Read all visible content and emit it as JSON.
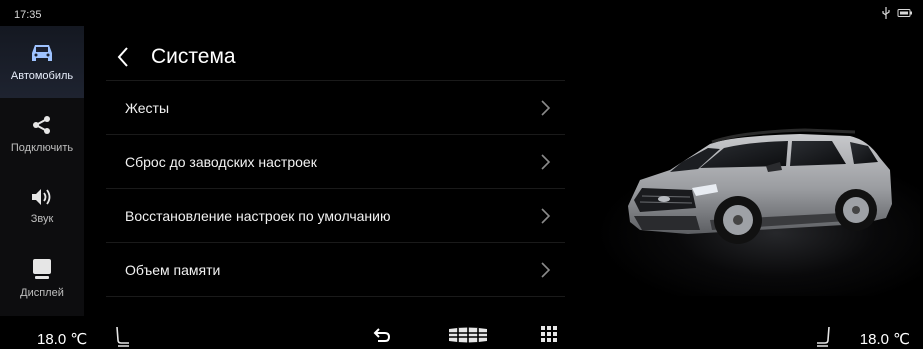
{
  "status": {
    "time": "17:35",
    "usb_icon": "usb-icon",
    "battery_icon": "battery-icon"
  },
  "sidebar": {
    "items": [
      {
        "label": "Автомобиль",
        "icon": "car-icon",
        "active": true
      },
      {
        "label": "Подключить",
        "icon": "share-icon",
        "active": false
      },
      {
        "label": "Звук",
        "icon": "speaker-icon",
        "active": false
      },
      {
        "label": "Дисплей",
        "icon": "display-icon",
        "active": false
      }
    ]
  },
  "header": {
    "title": "Система",
    "back_icon": "chevron-left-icon"
  },
  "menu": {
    "items": [
      {
        "label": "Жесты"
      },
      {
        "label": "Сброс до заводских настроек"
      },
      {
        "label": "Восстановление настроек по умолчанию"
      },
      {
        "label": "Объем памяти"
      }
    ]
  },
  "bottom": {
    "temp_left": "18.0 ℃",
    "temp_right": "18.0 ℃",
    "icons": [
      "seat-left-icon",
      "back-arrow-icon",
      "car-brand-icon",
      "apps-grid-icon",
      "seat-right-icon"
    ]
  },
  "colors": {
    "background": "#000000",
    "sidebar": "#0d0d0f",
    "active_item": "#1e2330",
    "text": "#ffffff"
  }
}
